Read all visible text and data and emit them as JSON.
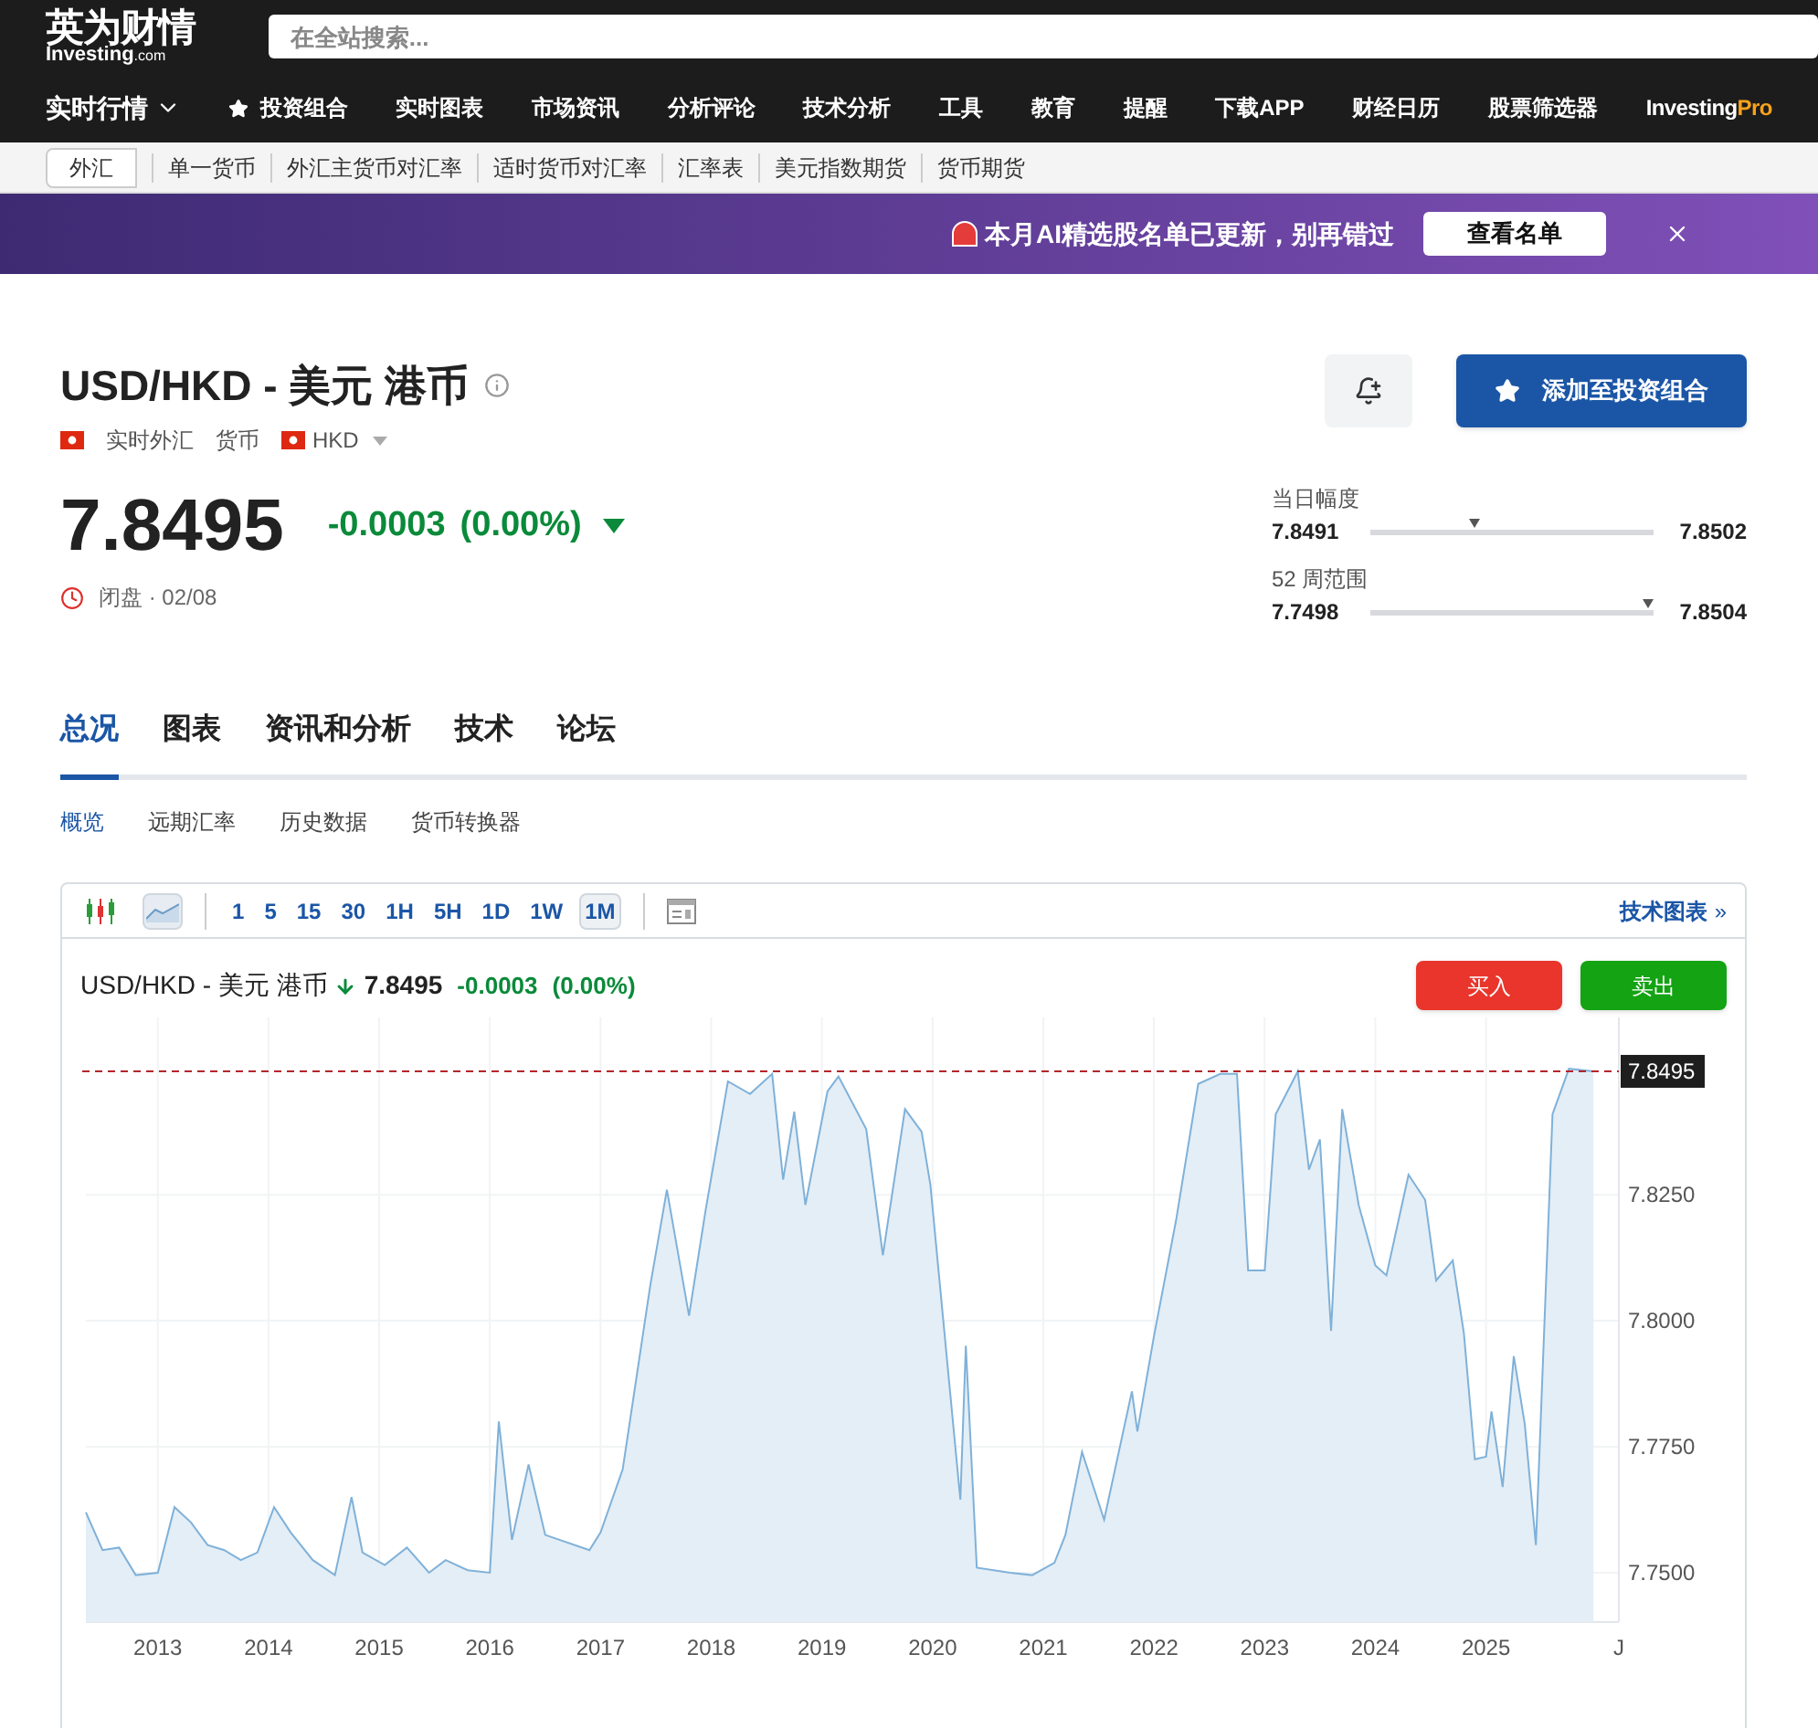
{
  "header": {
    "logo_cn": "英为财情",
    "logo_en": "Investing",
    "logo_domain": ".com"
  },
  "search": {
    "placeholder": "在全站搜索..."
  },
  "nav": [
    {
      "label": "实时行情",
      "kind": "dropdown"
    },
    {
      "label": "投资组合",
      "kind": "star"
    },
    {
      "label": "实时图表",
      "kind": "plain"
    },
    {
      "label": "市场资讯",
      "kind": "plain"
    },
    {
      "label": "分析评论",
      "kind": "plain"
    },
    {
      "label": "技术分析",
      "kind": "plain"
    },
    {
      "label": "工具",
      "kind": "plain"
    },
    {
      "label": "教育",
      "kind": "plain"
    },
    {
      "label": "提醒",
      "kind": "plain"
    },
    {
      "label": "下载APP",
      "kind": "plain"
    },
    {
      "label": "财经日历",
      "kind": "plain"
    },
    {
      "label": "股票筛选器",
      "kind": "plain"
    },
    {
      "label": "Investing",
      "suffix": "Pro",
      "kind": "brand"
    }
  ],
  "subnav": [
    {
      "label": "外汇",
      "selected": true
    },
    {
      "label": "单一货币",
      "selected": false
    },
    {
      "label": "外汇主货币对汇率",
      "selected": false
    },
    {
      "label": "适时货币对汇率",
      "selected": false
    },
    {
      "label": "汇率表",
      "selected": false
    },
    {
      "label": "美元指数期货",
      "selected": false
    },
    {
      "label": "货币期货",
      "selected": false
    }
  ],
  "promo": {
    "text": "本月AI精选股名单已更新，别再错过",
    "button": "查看名单"
  },
  "instrument": {
    "title": "USD/HKD - 美元 港币",
    "meta": [
      "实时外汇",
      "货币"
    ],
    "currency": "HKD",
    "price": "7.8495",
    "change": "-0.0003",
    "change_pct": "(0.00%)",
    "falling": true,
    "status": "闭盘 · 02/08"
  },
  "actions": {
    "add_button": "添加至投资组合"
  },
  "ranges": [
    {
      "label": "当日幅度",
      "low": "7.8491",
      "high": "7.8502",
      "level": 0.37
    },
    {
      "label": "52 周范围",
      "low": "7.7498",
      "high": "7.8504",
      "level": 0.98
    }
  ],
  "tabs": [
    {
      "label": "总况",
      "selected": true
    },
    {
      "label": "图表",
      "selected": false
    },
    {
      "label": "资讯和分析",
      "selected": false
    },
    {
      "label": "技术",
      "selected": false
    },
    {
      "label": "论坛",
      "selected": false
    }
  ],
  "subtabs": [
    {
      "label": "概览",
      "selected": true
    },
    {
      "label": "远期汇率",
      "selected": false
    },
    {
      "label": "历史数据",
      "selected": false
    },
    {
      "label": "货币转换器",
      "selected": false
    }
  ],
  "chart_toolbar": {
    "intervals": [
      {
        "label": "1",
        "selected": false
      },
      {
        "label": "5",
        "selected": false
      },
      {
        "label": "15",
        "selected": false
      },
      {
        "label": "30",
        "selected": false
      },
      {
        "label": "1H",
        "selected": false
      },
      {
        "label": "5H",
        "selected": false
      },
      {
        "label": "1D",
        "selected": false
      },
      {
        "label": "1W",
        "selected": false
      },
      {
        "label": "1M",
        "selected": true
      }
    ],
    "link": "技术图表",
    "link_arrow": "»"
  },
  "chart_header": {
    "title": "USD/HKD - 美元 港币",
    "falling": true,
    "price": "7.8495",
    "change": "-0.0003",
    "change_pct": "(0.00%)",
    "buy": "买入",
    "sell": "卖出"
  },
  "chart_data": {
    "type": "area",
    "x": [
      2012.35,
      2012.5,
      2012.65,
      2012.8,
      2013.0,
      2013.15,
      2013.3,
      2013.45,
      2013.6,
      2013.75,
      2013.9,
      2014.05,
      2014.2,
      2014.4,
      2014.6,
      2014.75,
      2014.85,
      2015.05,
      2015.25,
      2015.45,
      2015.6,
      2015.8,
      2016.0,
      2016.08,
      2016.2,
      2016.35,
      2016.5,
      2016.9,
      2017.0,
      2017.2,
      2017.45,
      2017.6,
      2017.8,
      2017.95,
      2018.15,
      2018.35,
      2018.55,
      2018.65,
      2018.75,
      2018.85,
      2019.05,
      2019.15,
      2019.4,
      2019.55,
      2019.75,
      2019.9,
      2019.98,
      2020.25,
      2020.3,
      2020.4,
      2020.7,
      2020.9,
      2021.1,
      2021.2,
      2021.35,
      2021.55,
      2021.8,
      2021.85,
      2022.0,
      2022.2,
      2022.4,
      2022.6,
      2022.75,
      2022.85,
      2023.0,
      2023.1,
      2023.3,
      2023.4,
      2023.5,
      2023.6,
      2023.7,
      2023.85,
      2024.0,
      2024.1,
      2024.3,
      2024.45,
      2024.55,
      2024.7,
      2024.8,
      2024.9,
      2025.0,
      2025.05,
      2025.15,
      2025.25,
      2025.35,
      2025.45,
      2025.6,
      2025.75,
      2025.97
    ],
    "series": [
      {
        "color": "#7fb1d9",
        "values": [
          7.762,
          7.7545,
          7.755,
          7.7495,
          7.75,
          7.763,
          7.76,
          7.7555,
          7.7545,
          7.7525,
          7.754,
          7.763,
          7.758,
          7.7525,
          7.7495,
          7.765,
          7.754,
          7.7515,
          7.755,
          7.75,
          7.7525,
          7.7505,
          7.75,
          7.78,
          7.7565,
          7.7715,
          7.7575,
          7.7545,
          7.758,
          7.7705,
          7.807,
          7.826,
          7.801,
          7.822,
          7.8475,
          7.845,
          7.849,
          7.828,
          7.8415,
          7.823,
          7.8455,
          7.8485,
          7.838,
          7.813,
          7.842,
          7.8375,
          7.827,
          7.7645,
          7.795,
          7.751,
          7.75,
          7.7495,
          7.752,
          7.7575,
          7.774,
          7.7605,
          7.786,
          7.778,
          7.797,
          7.82,
          7.847,
          7.849,
          7.849,
          7.81,
          7.81,
          7.841,
          7.8495,
          7.83,
          7.836,
          7.798,
          7.842,
          7.823,
          7.811,
          7.809,
          7.829,
          7.824,
          7.808,
          7.812,
          7.7975,
          7.7725,
          7.773,
          7.782,
          7.767,
          7.793,
          7.7795,
          7.7555,
          7.841,
          7.85,
          7.8495
        ]
      }
    ],
    "xlim": [
      2012.35,
      2026.2
    ],
    "ylim": [
      7.7402,
      7.8602
    ],
    "xticks": [
      2013,
      2014,
      2015,
      2016,
      2017,
      2018,
      2019,
      2020,
      2021,
      2022,
      2023,
      2024,
      2025,
      {
        "value": 2026.2,
        "label": "J"
      }
    ],
    "yticks": [
      {
        "value": 7.75,
        "label": "7.7500"
      },
      {
        "value": 7.775,
        "label": "7.7750"
      },
      {
        "value": 7.8,
        "label": "7.8000"
      },
      {
        "value": 7.825,
        "label": "7.8250"
      }
    ],
    "grid": true,
    "ref_lines": [
      {
        "axis": "y",
        "value": 7.8495,
        "label": "7.8495",
        "color": "#b3262b"
      }
    ]
  }
}
